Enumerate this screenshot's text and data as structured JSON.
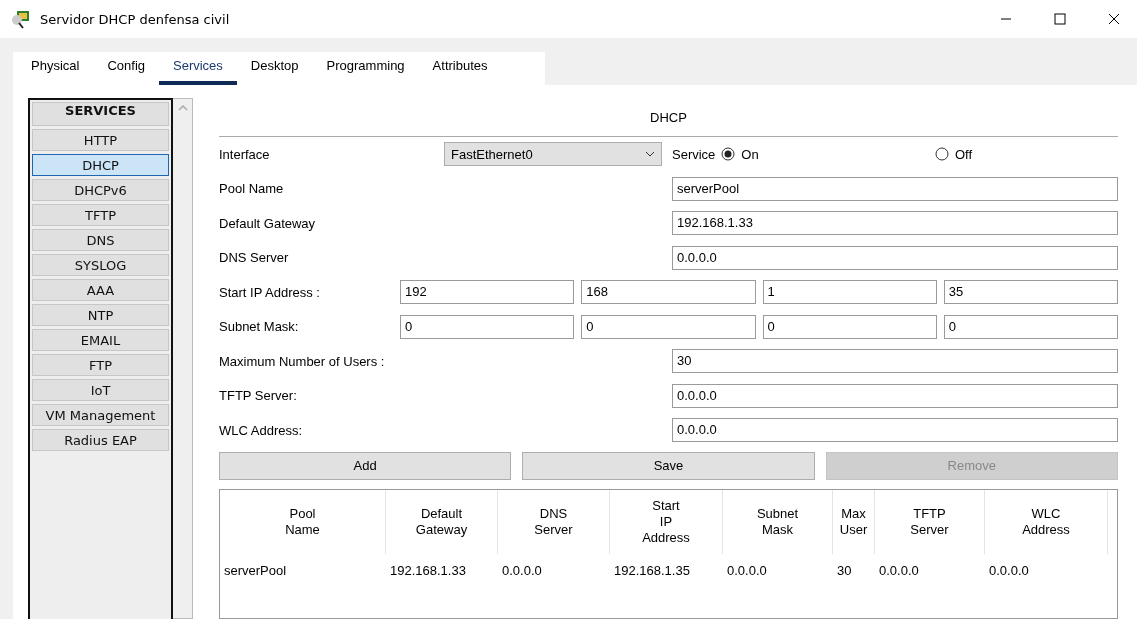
{
  "window": {
    "title": "Servidor DHCP denfensa civil"
  },
  "tabs": [
    {
      "label": "Physical",
      "selected": false
    },
    {
      "label": "Config",
      "selected": false
    },
    {
      "label": "Services",
      "selected": true
    },
    {
      "label": "Desktop",
      "selected": false
    },
    {
      "label": "Programming",
      "selected": false
    },
    {
      "label": "Attributes",
      "selected": false
    }
  ],
  "sidebar": {
    "header": "SERVICES",
    "items": [
      {
        "label": "HTTP",
        "selected": false
      },
      {
        "label": "DHCP",
        "selected": true
      },
      {
        "label": "DHCPv6",
        "selected": false
      },
      {
        "label": "TFTP",
        "selected": false
      },
      {
        "label": "DNS",
        "selected": false
      },
      {
        "label": "SYSLOG",
        "selected": false
      },
      {
        "label": "AAA",
        "selected": false
      },
      {
        "label": "NTP",
        "selected": false
      },
      {
        "label": "EMAIL",
        "selected": false
      },
      {
        "label": "FTP",
        "selected": false
      },
      {
        "label": "IoT",
        "selected": false
      },
      {
        "label": "VM Management",
        "selected": false
      },
      {
        "label": "Radius EAP",
        "selected": false
      }
    ]
  },
  "dhcp": {
    "title": "DHCP",
    "interface": {
      "label": "Interface",
      "value": "FastEthernet0"
    },
    "service": {
      "label": "Service",
      "options": [
        {
          "label": "On",
          "selected": true
        },
        {
          "label": "Off",
          "selected": false
        }
      ]
    },
    "fields": [
      {
        "kind": "single",
        "label": "Pool Name",
        "value": "serverPool"
      },
      {
        "kind": "single",
        "label": "Default Gateway",
        "value": "192.168.1.33"
      },
      {
        "kind": "single",
        "label": "DNS Server",
        "value": "0.0.0.0"
      },
      {
        "kind": "octets",
        "label": "Start IP Address :",
        "values": [
          "192",
          "168",
          "1",
          "35"
        ]
      },
      {
        "kind": "octets",
        "label": "Subnet Mask:",
        "values": [
          "0",
          "0",
          "0",
          "0"
        ]
      },
      {
        "kind": "single",
        "label": "Maximum Number of Users :",
        "value": "30"
      },
      {
        "kind": "single",
        "label": "TFTP Server:",
        "value": "0.0.0.0"
      },
      {
        "kind": "single",
        "label": "WLC Address:",
        "value": "0.0.0.0"
      }
    ],
    "buttons": [
      {
        "label": "Add",
        "disabled": false
      },
      {
        "label": "Save",
        "disabled": false
      },
      {
        "label": "Remove",
        "disabled": true
      }
    ],
    "table": {
      "columns": [
        "Pool\nName",
        "Default\nGateway",
        "DNS\nServer",
        "Start\nIP\nAddress",
        "Subnet\nMask",
        "Max\nUser",
        "TFTP\nServer",
        "WLC\nAddress"
      ],
      "rows": [
        [
          "serverPool",
          "192.168.1.33",
          "0.0.0.0",
          "192.168.1.35",
          "0.0.0.0",
          "30",
          "0.0.0.0",
          "0.0.0.0"
        ]
      ]
    }
  }
}
